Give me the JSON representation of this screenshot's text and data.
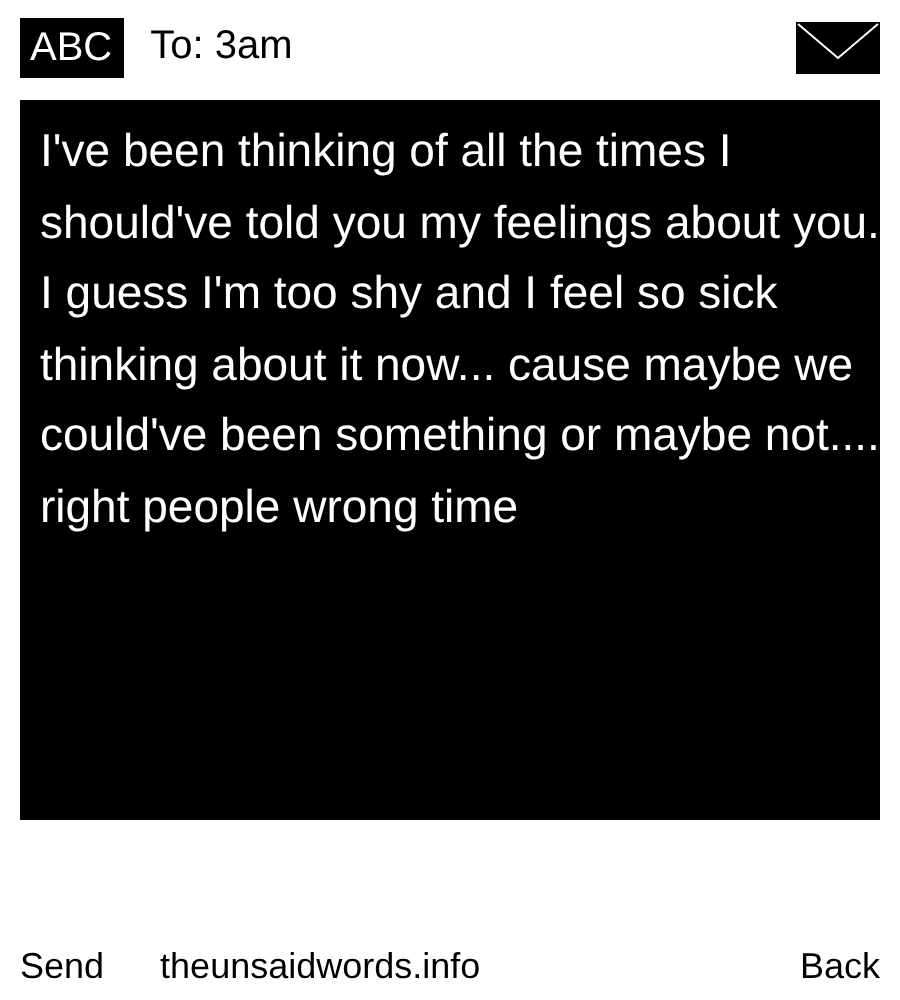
{
  "header": {
    "mode": "ABC",
    "recipient": "To: 3am"
  },
  "message": "I've been thinking of all the times I should've told you my feelings about you. I guess I'm too shy and I feel so sick thinking about it now... cause maybe we could've been something or maybe not.... right people wrong time",
  "softkeys": {
    "left": "Send",
    "center": "theunsaidwords.info",
    "right": "Back"
  }
}
